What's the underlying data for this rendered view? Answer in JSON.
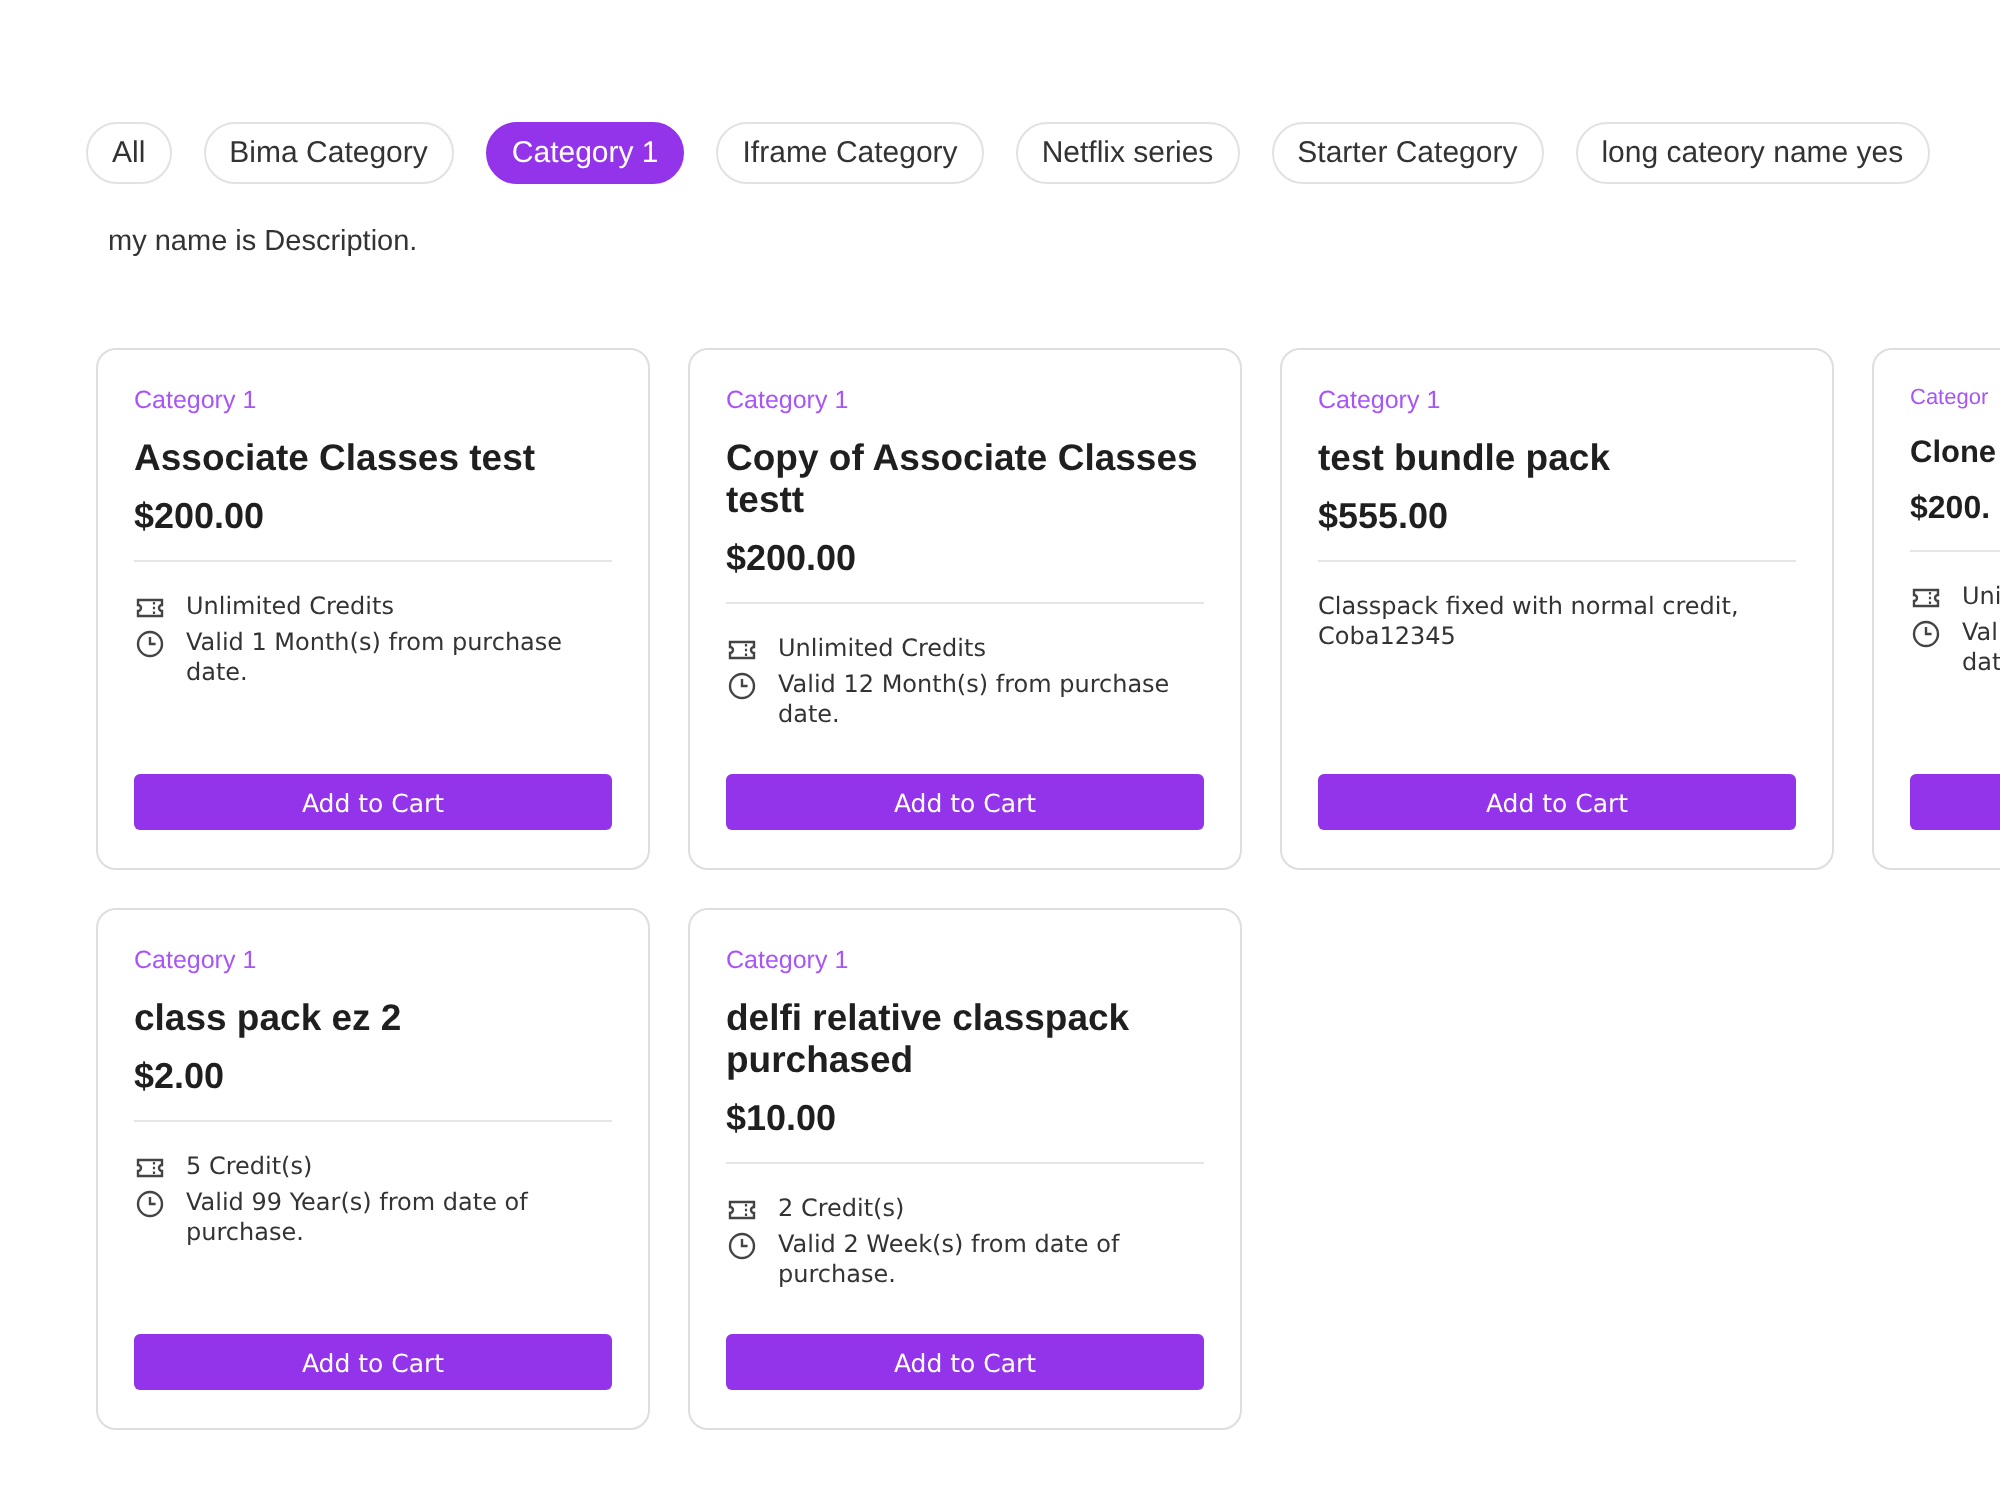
{
  "categories": [
    {
      "label": "All",
      "selected": false
    },
    {
      "label": "Bima Category",
      "selected": false
    },
    {
      "label": "Category 1",
      "selected": true
    },
    {
      "label": "Iframe Category",
      "selected": false
    },
    {
      "label": "Netflix series",
      "selected": false
    },
    {
      "label": "Starter Category",
      "selected": false
    },
    {
      "label": "long cateory name yes",
      "selected": false
    }
  ],
  "description": "my name is Description.",
  "products": [
    {
      "kind": "full",
      "category": "Category 1",
      "title": "Associate Classes test",
      "price": "$200.00",
      "details": [
        {
          "kind": "credits",
          "text": "Unlimited Credits"
        },
        {
          "kind": "validity",
          "text": "Valid 1 Month(s) from purchase date."
        }
      ],
      "button": "Add to Cart"
    },
    {
      "kind": "full",
      "category": "Category 1",
      "title": "Copy of Associate Classes testt",
      "price": "$200.00",
      "details": [
        {
          "kind": "credits",
          "text": "Unlimited Credits"
        },
        {
          "kind": "validity",
          "text": "Valid 12 Month(s) from purchase date."
        }
      ],
      "button": "Add to Cart"
    },
    {
      "kind": "full",
      "category": "Category 1",
      "title": "test bundle pack",
      "price": "$555.00",
      "details": [
        {
          "kind": "description",
          "text": "Classpack fixed with normal credit, Coba12345"
        }
      ],
      "button": "Add to Cart"
    },
    {
      "kind": "partial",
      "category": "Categor",
      "title": "Clone",
      "price": "$200.",
      "details": [
        {
          "kind": "credits",
          "text": "Uni"
        },
        {
          "kind": "validity",
          "text": "Val dat"
        }
      ]
    },
    {
      "kind": "full",
      "category": "Category 1",
      "title": "class pack ez 2",
      "price": "$2.00",
      "details": [
        {
          "kind": "credits",
          "text": "5 Credit(s)"
        },
        {
          "kind": "validity",
          "text": "Valid 99 Year(s) from date of purchase."
        }
      ],
      "button": "Add to Cart"
    },
    {
      "kind": "full",
      "category": "Category 1",
      "title": "delfi relative classpack purchased",
      "price": "$10.00",
      "details": [
        {
          "kind": "credits",
          "text": "2 Credit(s)"
        },
        {
          "kind": "validity",
          "text": "Valid 2 Week(s) from date of purchase."
        }
      ],
      "button": "Add to Cart"
    }
  ]
}
